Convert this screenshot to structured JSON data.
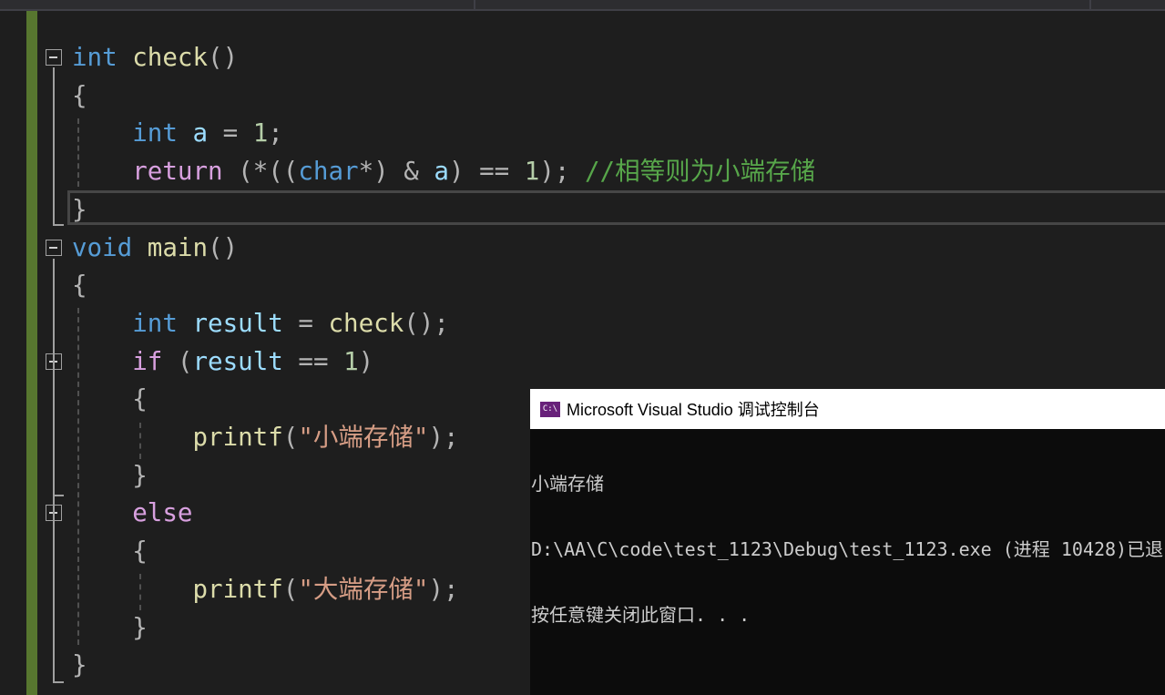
{
  "editor": {
    "lines": [
      [
        [
          "int",
          "kw"
        ],
        [
          " ",
          "pun"
        ],
        [
          "check",
          "fn"
        ],
        [
          "()",
          "pun"
        ]
      ],
      [
        [
          "{",
          "pun"
        ]
      ],
      [
        [
          "    ",
          "pun"
        ],
        [
          "int",
          "kw"
        ],
        [
          " ",
          "pun"
        ],
        [
          "a",
          "var"
        ],
        [
          " = ",
          "pun"
        ],
        [
          "1",
          "num"
        ],
        [
          ";",
          "pun"
        ]
      ],
      [
        [
          "    ",
          "pun"
        ],
        [
          "return",
          "ctl"
        ],
        [
          " (*((",
          "pun"
        ],
        [
          "char",
          "kw"
        ],
        [
          "*) & ",
          "pun"
        ],
        [
          "a",
          "var"
        ],
        [
          ") == ",
          "pun"
        ],
        [
          "1",
          "num"
        ],
        [
          "); ",
          "pun"
        ],
        [
          "//相等则为小端存储",
          "cmt"
        ]
      ],
      [
        [
          "}",
          "pun"
        ]
      ],
      [
        [
          "void",
          "kw"
        ],
        [
          " ",
          "pun"
        ],
        [
          "main",
          "fn"
        ],
        [
          "()",
          "pun"
        ]
      ],
      [
        [
          "{",
          "pun"
        ]
      ],
      [
        [
          "    ",
          "pun"
        ],
        [
          "int",
          "kw"
        ],
        [
          " ",
          "pun"
        ],
        [
          "result",
          "var"
        ],
        [
          " = ",
          "pun"
        ],
        [
          "check",
          "fn"
        ],
        [
          "();",
          "pun"
        ]
      ],
      [
        [
          "    ",
          "pun"
        ],
        [
          "if",
          "ctl"
        ],
        [
          " (",
          "pun"
        ],
        [
          "result",
          "var"
        ],
        [
          " == ",
          "pun"
        ],
        [
          "1",
          "num"
        ],
        [
          ")",
          "pun"
        ]
      ],
      [
        [
          "    {",
          "pun"
        ]
      ],
      [
        [
          "        ",
          "pun"
        ],
        [
          "printf",
          "fn"
        ],
        [
          "(",
          "pun"
        ],
        [
          "\"小端存储\"",
          "str"
        ],
        [
          ");",
          "pun"
        ]
      ],
      [
        [
          "    }",
          "pun"
        ]
      ],
      [
        [
          "    ",
          "pun"
        ],
        [
          "else",
          "ctl"
        ]
      ],
      [
        [
          "    {",
          "pun"
        ]
      ],
      [
        [
          "        ",
          "pun"
        ],
        [
          "printf",
          "fn"
        ],
        [
          "(",
          "pun"
        ],
        [
          "\"大端存储\"",
          "str"
        ],
        [
          ");",
          "pun"
        ]
      ],
      [
        [
          "    }",
          "pun"
        ]
      ],
      [
        [
          "}",
          "pun"
        ]
      ]
    ]
  },
  "console": {
    "icon": "console-app-icon",
    "icon_text": "C:\\",
    "title": "Microsoft Visual Studio 调试控制台",
    "output": [
      "小端存储",
      "D:\\AA\\C\\code\\test_1123\\Debug\\test_1123.exe (进程 10428)已退",
      "按任意键关闭此窗口. . ."
    ]
  }
}
